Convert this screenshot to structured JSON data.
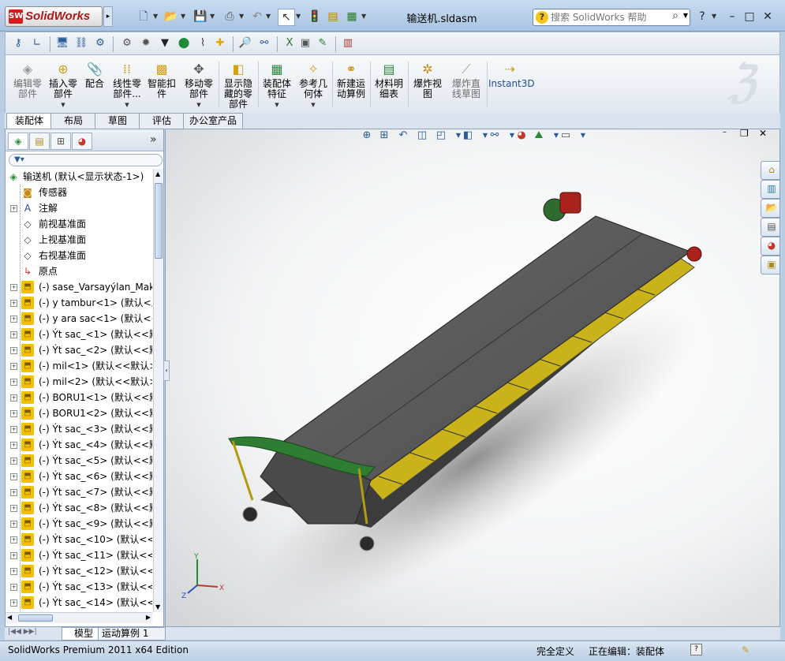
{
  "app": {
    "logo_text": "SolidWorks",
    "logo_badge": "SW",
    "document_title": "输送机.sldasm"
  },
  "search": {
    "placeholder": "搜索 SolidWorks 帮助",
    "help_icon": "?"
  },
  "window_controls": {
    "help": "?",
    "minimize": "–",
    "maximize": "□",
    "close": "✕"
  },
  "ribbon": {
    "buttons": [
      {
        "label": "编辑零\n部件",
        "icon": "edit-component-icon",
        "enabled": false
      },
      {
        "label": "插入零\n部件",
        "icon": "insert-component-icon",
        "enabled": true,
        "dropdown": true
      },
      {
        "label": "配合",
        "icon": "mate-icon",
        "enabled": true
      },
      {
        "label": "线性零\n部件...",
        "icon": "linear-pattern-icon",
        "enabled": true,
        "dropdown": true
      },
      {
        "label": "智能扣\n件",
        "icon": "smart-fastener-icon",
        "enabled": true
      },
      {
        "label": "移动零\n部件",
        "icon": "move-component-icon",
        "enabled": true,
        "dropdown": true
      },
      {
        "label": "显示隐\n藏的零\n部件",
        "icon": "show-hidden-icon",
        "enabled": true
      },
      {
        "label": "装配体\n特征",
        "icon": "assembly-feature-icon",
        "enabled": true,
        "dropdown": true
      },
      {
        "label": "参考几\n何体",
        "icon": "reference-geometry-icon",
        "enabled": true,
        "dropdown": true
      },
      {
        "label": "新建运\n动算例",
        "icon": "motion-study-icon",
        "enabled": true
      },
      {
        "label": "材料明\n细表",
        "icon": "bom-icon",
        "enabled": true
      },
      {
        "label": "爆炸视\n图",
        "icon": "exploded-view-icon",
        "enabled": true
      },
      {
        "label": "爆炸直\n线草图",
        "icon": "explode-line-icon",
        "enabled": false
      },
      {
        "label": "Instant3D",
        "icon": "instant3d-icon",
        "enabled": true
      }
    ]
  },
  "command_tabs": [
    "装配体",
    "布局",
    "草图",
    "评估",
    "办公室产品"
  ],
  "feature_tree": {
    "root": "输送机 (默认<显示状态-1>)",
    "items": [
      {
        "label": "传感器",
        "icon": "sensor-icon",
        "expandable": false
      },
      {
        "label": "注解",
        "icon": "annotation-icon",
        "expandable": true
      },
      {
        "label": "前视基准面",
        "icon": "plane-icon",
        "expandable": false
      },
      {
        "label": "上视基准面",
        "icon": "plane-icon",
        "expandable": false
      },
      {
        "label": "右视基准面",
        "icon": "plane-icon",
        "expandable": false
      },
      {
        "label": "原点",
        "icon": "origin-icon",
        "expandable": false
      },
      {
        "label": "(-) sase_Varsayýlan_Mak",
        "icon": "part-icon",
        "expandable": true
      },
      {
        "label": "(-) y tambur<1> (默认<显",
        "icon": "part-icon",
        "expandable": true
      },
      {
        "label": "(-) y ara sac<1> (默认<<",
        "icon": "part-icon",
        "expandable": true
      },
      {
        "label": "(-) Ýt sac_<1> (默认<<默",
        "icon": "part-icon",
        "expandable": true
      },
      {
        "label": "(-) Ýt sac_<2> (默认<<默",
        "icon": "part-icon",
        "expandable": true
      },
      {
        "label": "(-) mil<1> (默认<<默认>",
        "icon": "part-icon",
        "expandable": true
      },
      {
        "label": "(-) mil<2> (默认<<默认>",
        "icon": "part-icon",
        "expandable": true
      },
      {
        "label": "(-) BORU1<1> (默认<<默",
        "icon": "part-icon",
        "expandable": true
      },
      {
        "label": "(-) BORU1<2> (默认<<默",
        "icon": "part-icon",
        "expandable": true
      },
      {
        "label": "(-) Ýt sac_<3> (默认<<默",
        "icon": "part-icon",
        "expandable": true
      },
      {
        "label": "(-) Ýt sac_<4> (默认<<默",
        "icon": "part-icon",
        "expandable": true
      },
      {
        "label": "(-) Ýt sac_<5> (默认<<默",
        "icon": "part-icon",
        "expandable": true
      },
      {
        "label": "(-) Ýt sac_<6> (默认<<默",
        "icon": "part-icon",
        "expandable": true
      },
      {
        "label": "(-) Ýt sac_<7> (默认<<默",
        "icon": "part-icon",
        "expandable": true
      },
      {
        "label": "(-) Ýt sac_<8> (默认<<默",
        "icon": "part-icon",
        "expandable": true
      },
      {
        "label": "(-) Ýt sac_<9> (默认<<默",
        "icon": "part-icon",
        "expandable": true
      },
      {
        "label": "(-) Ýt sac_<10> (默认<<",
        "icon": "part-icon",
        "expandable": true
      },
      {
        "label": "(-) Ýt sac_<11> (默认<<",
        "icon": "part-icon",
        "expandable": true
      },
      {
        "label": "(-) Ýt sac_<12> (默认<<",
        "icon": "part-icon",
        "expandable": true
      },
      {
        "label": "(-) Ýt sac_<13> (默认<<",
        "icon": "part-icon",
        "expandable": true
      },
      {
        "label": "(-) Ýt sac_<14> (默认<<",
        "icon": "part-icon",
        "expandable": true
      }
    ]
  },
  "bottom_tabs": [
    "模型",
    "运动算例 1"
  ],
  "status": {
    "product": "SolidWorks Premium 2011 x64 Edition",
    "constraint": "完全定义",
    "editing": "正在编辑：装配体"
  },
  "axes": {
    "x": "X",
    "y": "Y",
    "z": "Z"
  },
  "colors": {
    "frame_blue": "#b9cde3",
    "tree_part_yellow": "#f2c200",
    "belt_gray": "#555555",
    "rail_yellow": "#d8c31b",
    "motor_red": "#b3261e",
    "guard_green": "#2e7d32"
  }
}
